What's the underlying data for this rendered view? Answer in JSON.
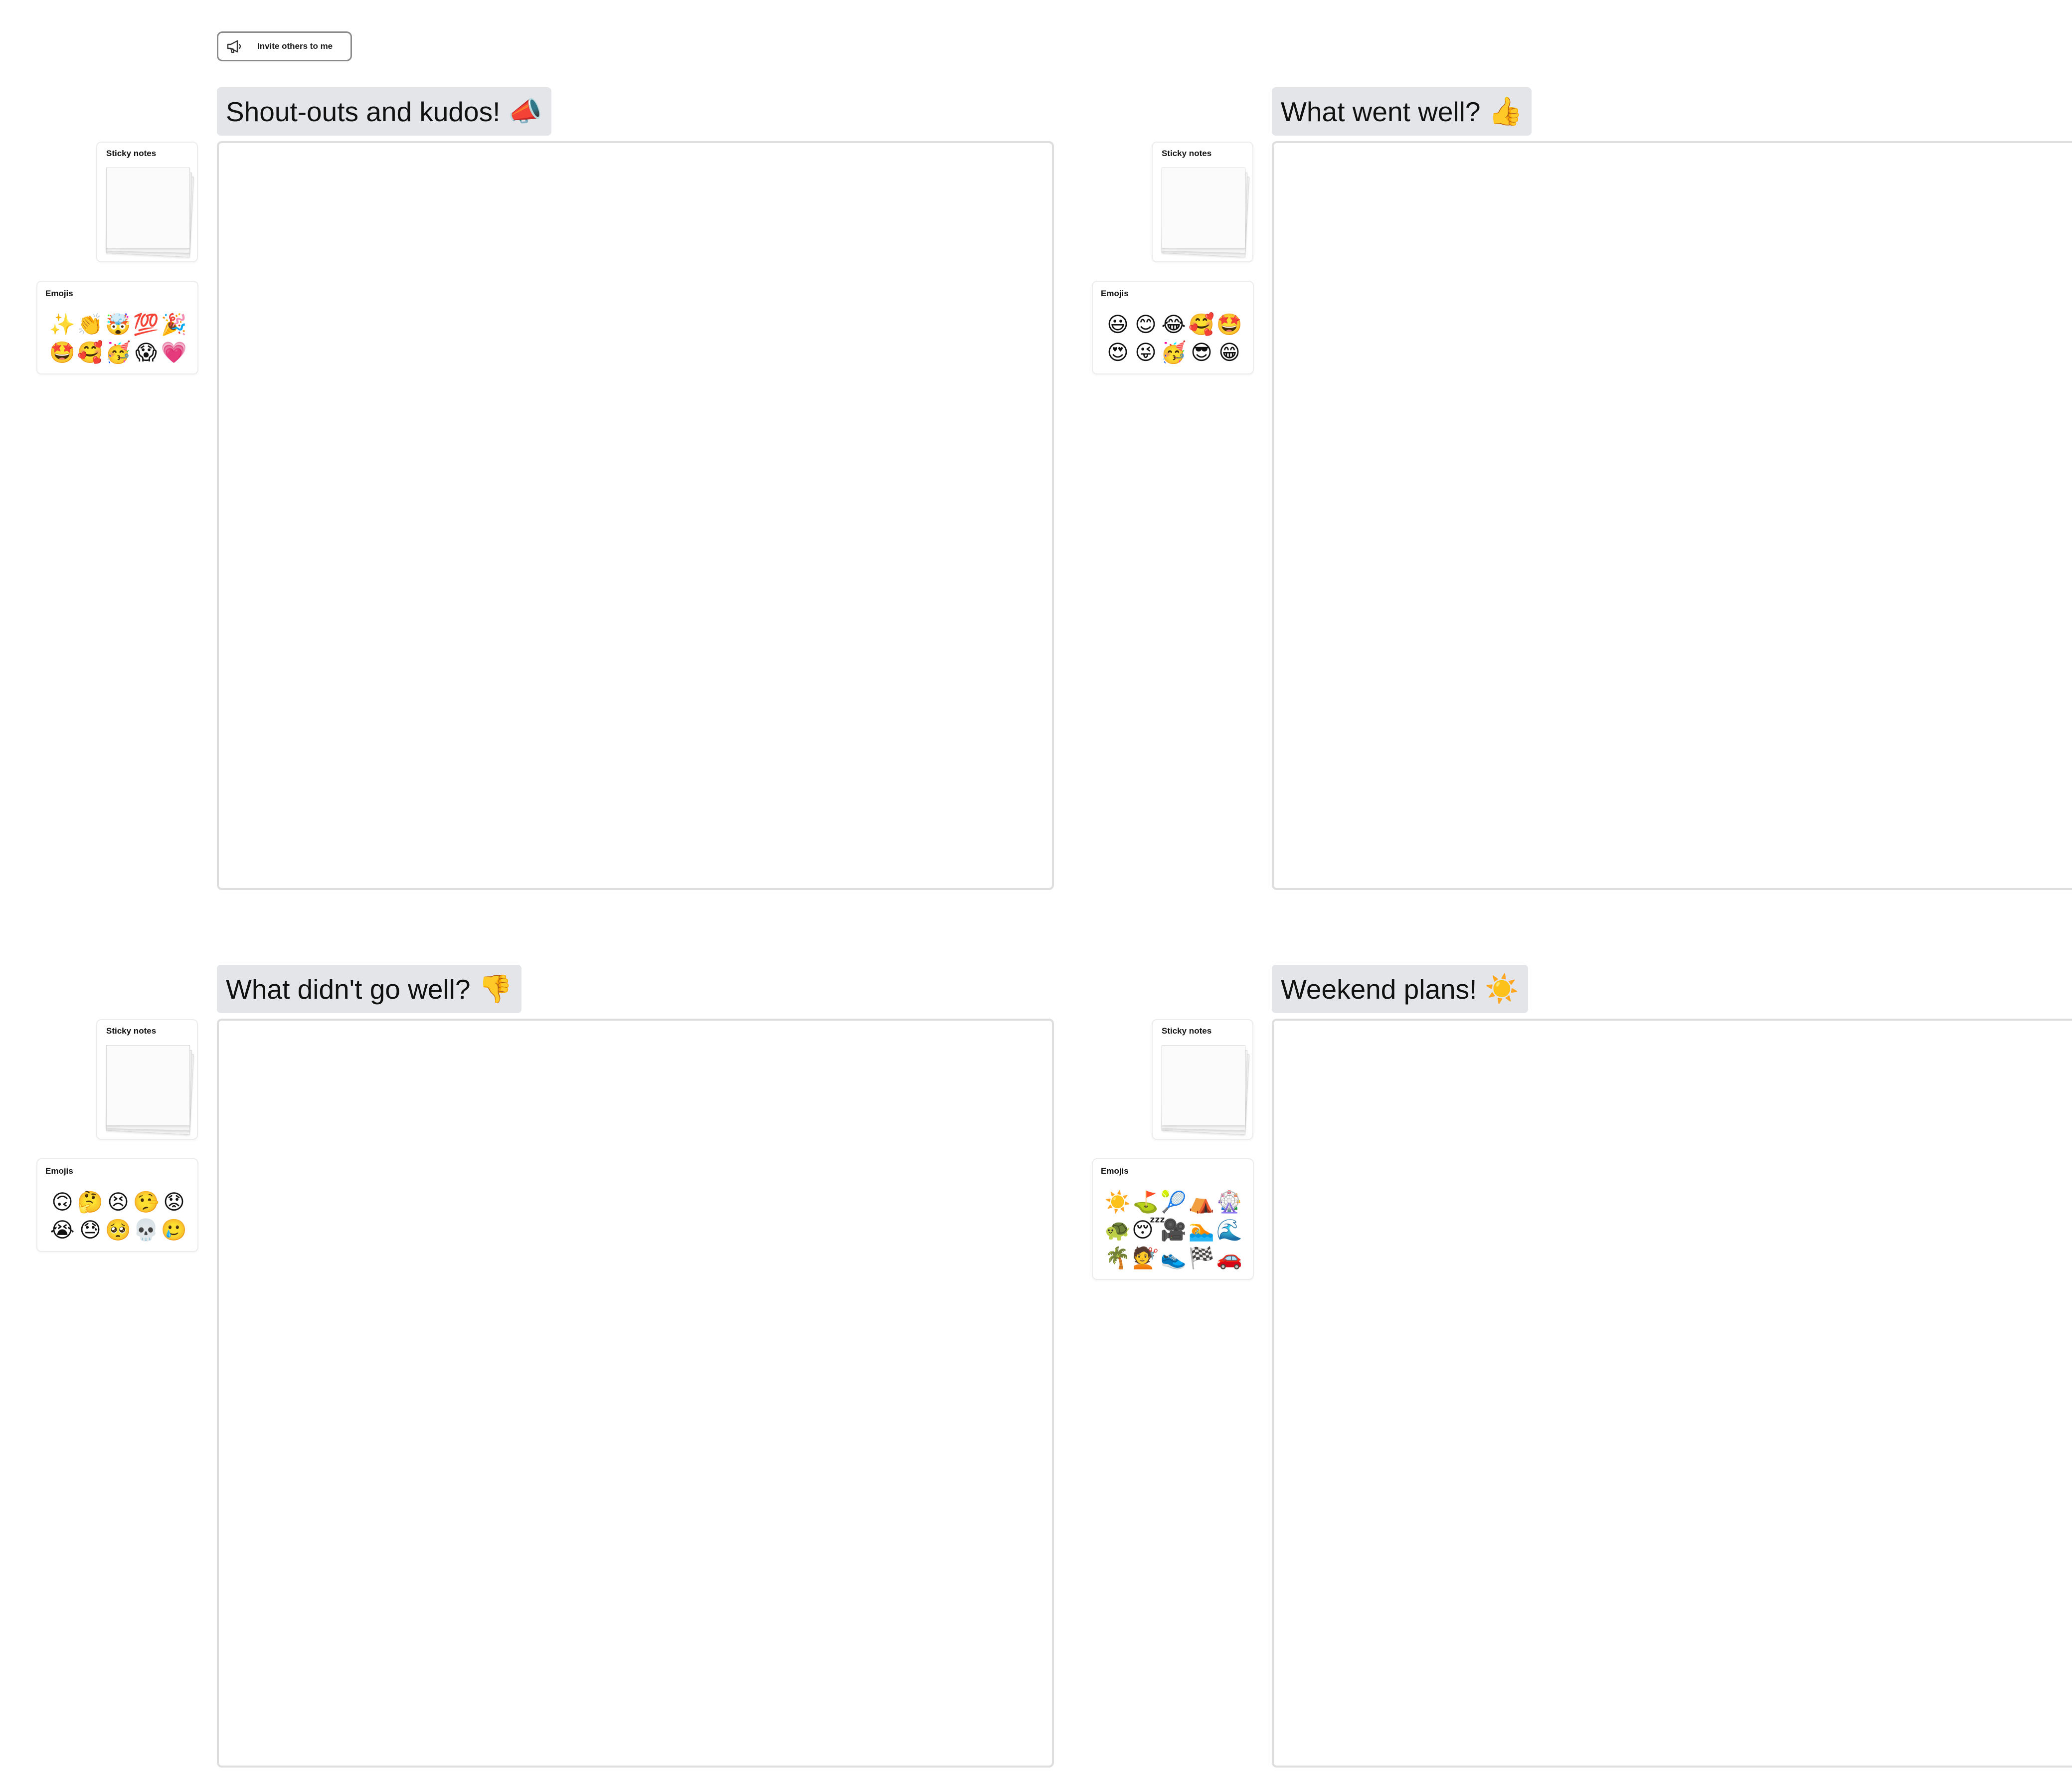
{
  "toolbar": {
    "invite_label": "Invite others to me",
    "invite_icon": "megaphone-icon"
  },
  "widgets": {
    "sticky_label": "Sticky notes",
    "emoji_label": "Emojis"
  },
  "sections": [
    {
      "title": "Shout-outs and kudos!",
      "title_emoji": "📣",
      "emojis": [
        "✨",
        "👏",
        "🤯",
        "💯",
        "🎉",
        "🤩",
        "🥰",
        "🥳",
        "😱",
        "💗"
      ]
    },
    {
      "title": "What went well?",
      "title_emoji": "👍",
      "emojis": [
        "😃",
        "😊",
        "😂",
        "🥰",
        "🤩",
        "😍",
        "😜",
        "🥳",
        "😎",
        "😁"
      ]
    },
    {
      "title": "What didn't go well?",
      "title_emoji": "👎",
      "emojis": [
        "🙃",
        "🤔",
        "😣",
        "🤥",
        "😟",
        "😭",
        "😓",
        "🥺",
        "💀",
        "🥲"
      ]
    },
    {
      "title": "Weekend plans!",
      "title_emoji": "☀️",
      "emojis": [
        "☀️",
        "⛳",
        "🎾",
        "⛺",
        "🎡",
        "🐢",
        "😴",
        "🎥",
        "🏊",
        "🌊",
        "🌴",
        "💇",
        "👟",
        "🏁",
        "🚗"
      ]
    }
  ]
}
